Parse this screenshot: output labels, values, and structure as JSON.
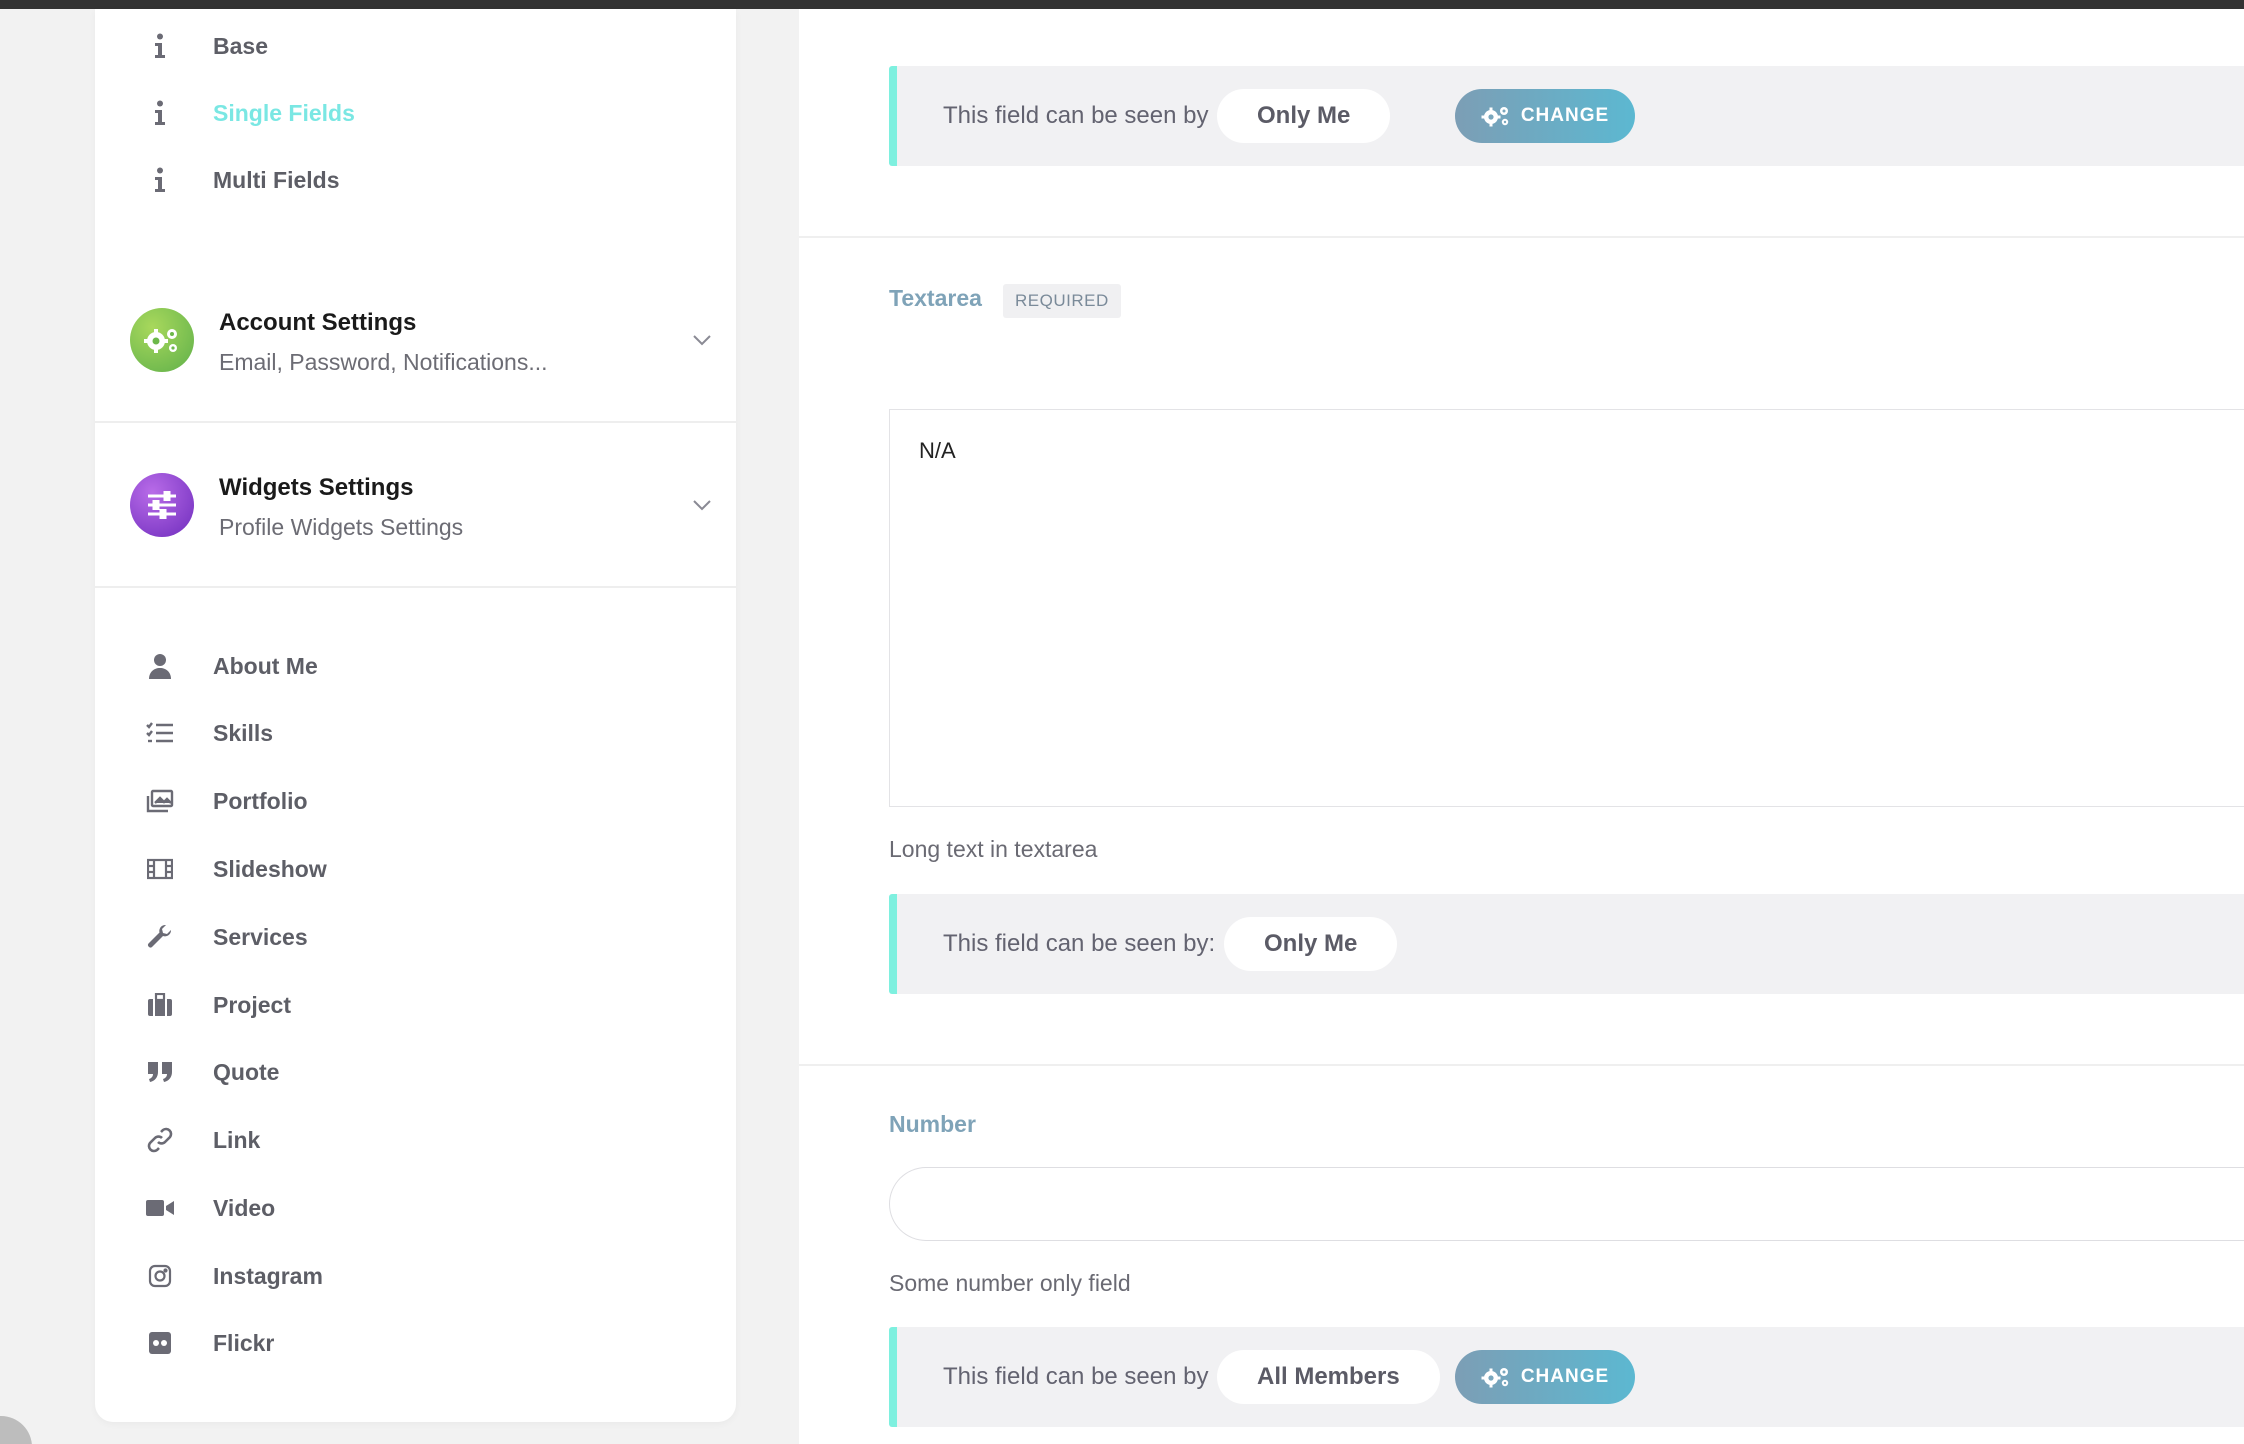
{
  "sidebar": {
    "top_items": [
      {
        "label": "Base",
        "icon": "info-icon"
      },
      {
        "label": "Single Fields",
        "icon": "info-icon",
        "active": true
      },
      {
        "label": "Multi Fields",
        "icon": "info-icon"
      }
    ],
    "sections": [
      {
        "title": "Account Settings",
        "subtitle": "Email, Password, Notifications...",
        "icon": "gears-icon",
        "color": "#7cc046"
      },
      {
        "title": "Widgets Settings",
        "subtitle": "Profile Widgets Settings",
        "icon": "sliders-icon",
        "color": "#8a3fd0"
      }
    ],
    "widgets": [
      {
        "label": "About Me",
        "icon": "user-icon"
      },
      {
        "label": "Skills",
        "icon": "checklist-icon"
      },
      {
        "label": "Portfolio",
        "icon": "images-icon"
      },
      {
        "label": "Slideshow",
        "icon": "film-icon"
      },
      {
        "label": "Services",
        "icon": "wrench-icon"
      },
      {
        "label": "Project",
        "icon": "briefcase-icon"
      },
      {
        "label": "Quote",
        "icon": "quote-icon"
      },
      {
        "label": "Link",
        "icon": "link-icon"
      },
      {
        "label": "Video",
        "icon": "video-camera-icon"
      },
      {
        "label": "Instagram",
        "icon": "instagram-icon"
      },
      {
        "label": "Flickr",
        "icon": "flickr-icon"
      }
    ],
    "active_color": "#7ae7e3"
  },
  "main": {
    "visibility_1": {
      "text": "This field can be seen by",
      "value": "Only Me",
      "button": "CHANGE"
    },
    "textarea_field": {
      "label": "Textarea",
      "badge": "REQUIRED",
      "value": "N/A",
      "help": "Long text in textarea"
    },
    "visibility_2": {
      "text": "This field can be seen by:",
      "value": "Only Me"
    },
    "number_field": {
      "label": "Number",
      "value": "",
      "help": "Some number only field"
    },
    "visibility_3": {
      "text": "This field can be seen by",
      "value": "All Members",
      "button": "CHANGE"
    },
    "accent_color": "#7ef0df",
    "button_gradient": [
      "#7c9eb5",
      "#5cb8d1"
    ]
  }
}
